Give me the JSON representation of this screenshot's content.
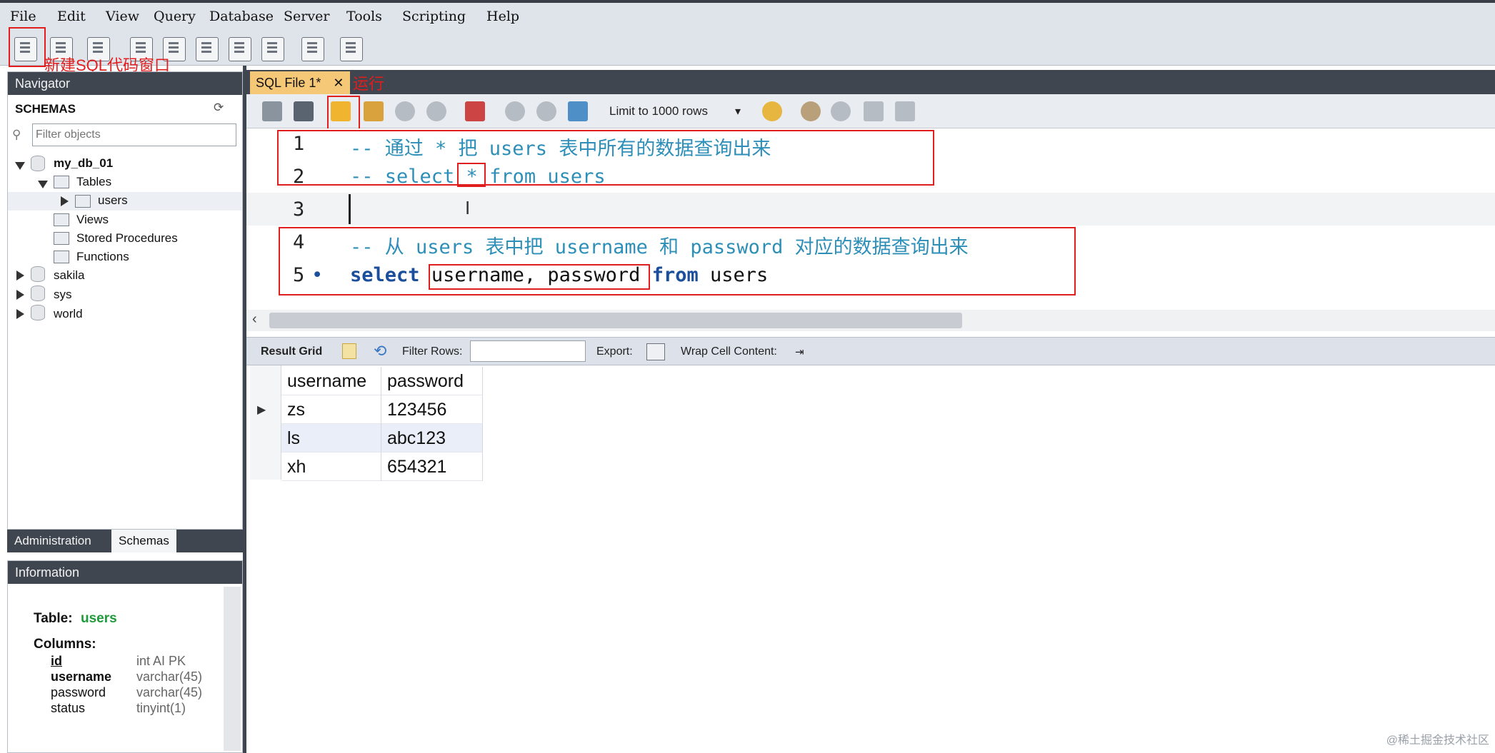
{
  "menu": [
    "File",
    "Edit",
    "View",
    "Query",
    "Database",
    "Server",
    "Tools",
    "Scripting",
    "Help"
  ],
  "annotations": {
    "new_sql": "新建SQL代码窗口",
    "run": "运行"
  },
  "navigator": {
    "title": "Navigator",
    "schemas_label": "SCHEMAS",
    "filter_placeholder": "Filter objects",
    "db_main": "my_db_01",
    "tables": "Tables",
    "table_users": "users",
    "views": "Views",
    "stored_procedures": "Stored Procedures",
    "functions": "Functions",
    "db_others": [
      "sakila",
      "sys",
      "world"
    ]
  },
  "bottom_tabs": [
    "Administration",
    "Schemas"
  ],
  "information": {
    "title": "Information",
    "table_label": "Table:",
    "table_name": "users",
    "columns_label": "Columns:",
    "columns": [
      {
        "name": "id",
        "type": "int AI PK"
      },
      {
        "name": "username",
        "type": "varchar(45)"
      },
      {
        "name": "password",
        "type": "varchar(45)"
      },
      {
        "name": "status",
        "type": "tinyint(1)"
      }
    ]
  },
  "editor": {
    "tab_label": "SQL File 1*",
    "limit_label": "Limit to 1000 rows",
    "lines": [
      {
        "num": "1",
        "text": "-- 通过 * 把 users 表中所有的数据查询出来"
      },
      {
        "num": "2",
        "text": "-- select * from users"
      },
      {
        "num": "3",
        "text": ""
      },
      {
        "num": "4",
        "text": "-- 从 users 表中把 username 和 password 对应的数据查询出来"
      },
      {
        "num": "5",
        "text": ""
      }
    ],
    "line5": {
      "kw1": "select",
      "cols": "username, password",
      "kw2": "from",
      "table": "users"
    }
  },
  "result": {
    "result_grid_label": "Result Grid",
    "filter_rows_label": "Filter Rows:",
    "export_label": "Export:",
    "wrap_label": "Wrap Cell Content:",
    "headers": [
      "username",
      "password"
    ],
    "rows": [
      [
        "zs",
        "123456"
      ],
      [
        "ls",
        "abc123"
      ],
      [
        "xh",
        "654321"
      ]
    ]
  },
  "watermark": "@稀土掘金技术社区"
}
